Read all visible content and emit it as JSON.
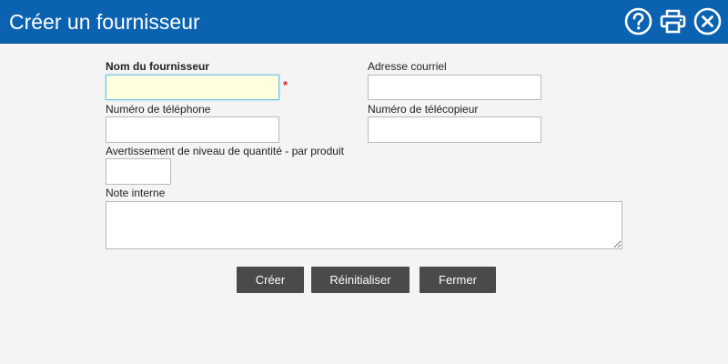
{
  "window": {
    "title": "Créer un fournisseur",
    "icons": [
      "help-icon",
      "print-icon",
      "close-icon"
    ],
    "colors": {
      "titlebar": "#0b62b0",
      "button": "#4a4a4a",
      "required": "#e02020"
    }
  },
  "form": {
    "supplier_name_label": "Nom du fournisseur",
    "supplier_name_value": "",
    "required_marker": "*",
    "email_label": "Adresse courriel",
    "email_value": "",
    "phone_label": "Numéro de téléphone",
    "phone_value": "",
    "fax_label": "Numéro de télécopieur",
    "fax_value": "",
    "quantity_warning_label": "Avertissement de niveau de quantité - par produit",
    "quantity_warning_value": "",
    "internal_note_label": "Note interne",
    "internal_note_value": ""
  },
  "buttons": {
    "create": "Créer",
    "reset": "Réinitialiser",
    "close": "Fermer"
  }
}
